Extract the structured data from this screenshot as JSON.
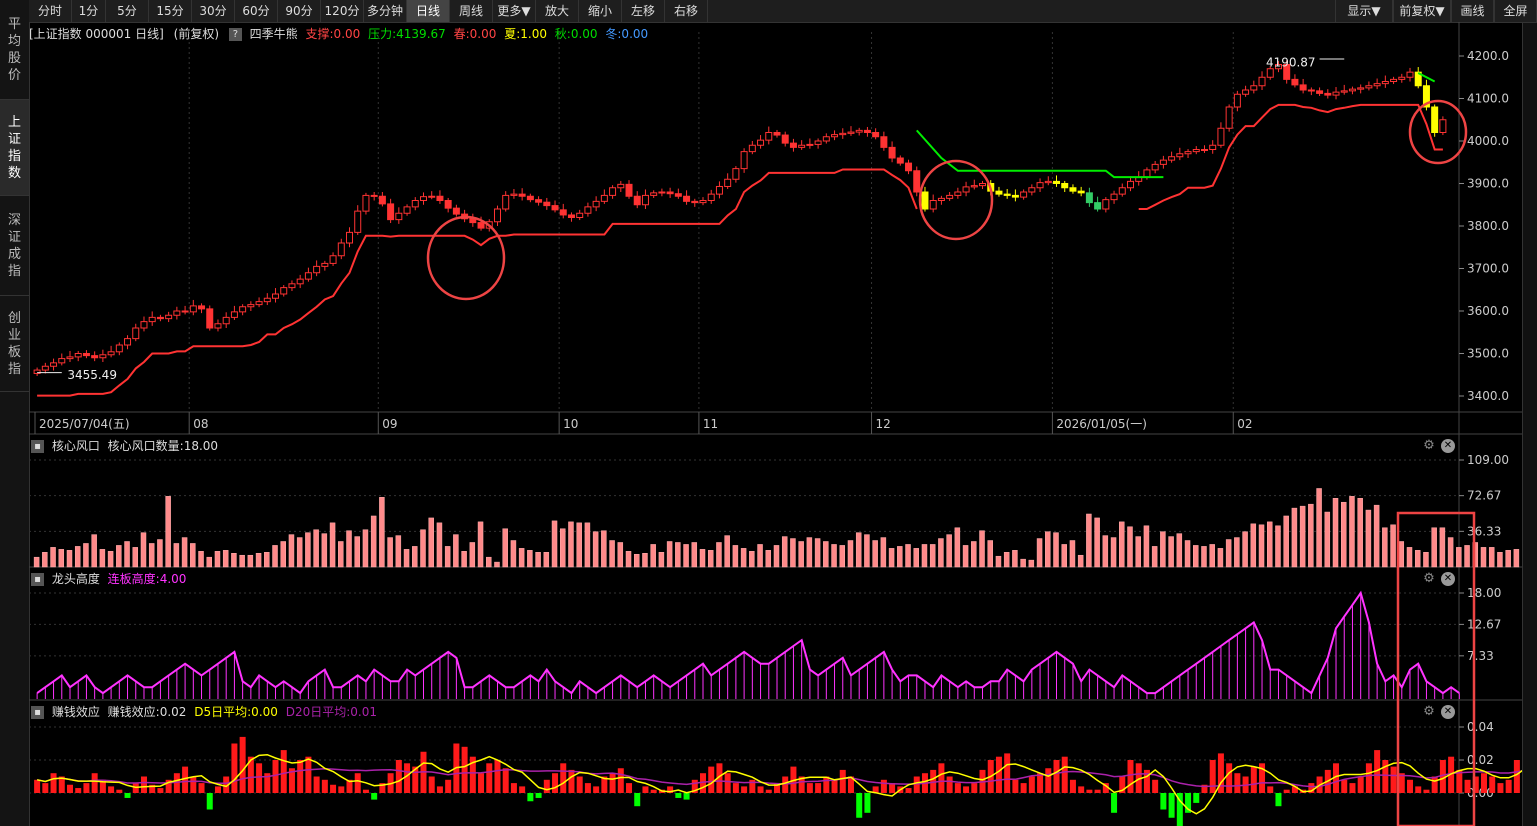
{
  "left_nav": [
    {
      "label": "平均股价"
    },
    {
      "label": "上证指数",
      "active": true
    },
    {
      "label": "深证成指"
    },
    {
      "label": "创业板指"
    }
  ],
  "toolbar": {
    "left": [
      "分时",
      "1分",
      "5分",
      "15分",
      "30分",
      "60分",
      "90分",
      "120分",
      "多分钟",
      "日线",
      "周线",
      "更多▼",
      "放大",
      "缩小",
      "左移",
      "右移"
    ],
    "active": "日线",
    "right": [
      "显示▼",
      "前复权▼",
      "画线",
      "全屏"
    ]
  },
  "info": {
    "security": "[上证指数 000001 日线]",
    "adjust": "(前复权)",
    "indicator": "四季牛熊",
    "support": "支撑:0.00",
    "pressure": "压力:4139.67",
    "spring": "春:0.00",
    "summer": "夏:1.00",
    "autumn": "秋:0.00",
    "winter": "冬:0.00"
  },
  "colors": {
    "up": "#ff3333",
    "down_yellow": "#ffff00",
    "green": "#00ee00",
    "magenta": "#ff33ff",
    "salmon": "#ff8a8a"
  },
  "chart_data": [
    {
      "type": "line",
      "title": "上证指数 000001 日线",
      "ylim": [
        3400,
        4200
      ],
      "y_ticks": [
        "4200.0",
        "4100.0",
        "4000.0",
        "3900.0",
        "3800.0",
        "3700.0",
        "3600.0",
        "3500.0",
        "3400.0"
      ],
      "x_ticks": [
        "2025/07/04(五)",
        "08",
        "09",
        "10",
        "11",
        "12",
        "2026/01/05(一)",
        "02"
      ],
      "annotations": [
        "4190.87",
        "3455.49"
      ],
      "series": [
        {
          "name": "",
          "values": [
            3461,
            3470,
            3478,
            3488,
            3492,
            3500,
            3495,
            3490,
            3497,
            3504,
            3520,
            3535,
            3560,
            3575,
            3585,
            3582,
            3590,
            3600,
            3598,
            3612,
            3605,
            3560,
            3570,
            3585,
            3598,
            3610,
            3615,
            3622,
            3630,
            3640,
            3655,
            3664,
            3675,
            3690,
            3705,
            3712,
            3730,
            3760,
            3785,
            3835,
            3872,
            3870,
            3852,
            3815,
            3830,
            3845,
            3860,
            3869,
            3870,
            3860,
            3842,
            3828,
            3817,
            3808,
            3795,
            3810,
            3840,
            3872,
            3875,
            3870,
            3862,
            3856,
            3848,
            3838,
            3826,
            3820,
            3830,
            3845,
            3858,
            3872,
            3890,
            3898,
            3870,
            3850,
            3872,
            3878,
            3880,
            3876,
            3870,
            3858,
            3855,
            3860,
            3875,
            3893,
            3910,
            3935,
            3975,
            3990,
            4002,
            4020,
            4014,
            3995,
            3985,
            3990,
            3992,
            4000,
            4010,
            4015,
            4018,
            4021,
            4025,
            4020,
            4010,
            3985,
            3960,
            3948,
            3930,
            3880,
            3840,
            3860,
            3865,
            3872,
            3880,
            3892,
            3895,
            3900,
            3882,
            3875,
            3872,
            3868,
            3880,
            3890,
            3902,
            3905,
            3900,
            3890,
            3882,
            3878,
            3855,
            3840,
            3862,
            3875,
            3890,
            3905,
            3915,
            3932,
            3945,
            3955,
            3963,
            3970,
            3975,
            3980,
            3980,
            3990,
            4030,
            4080,
            4110,
            4120,
            4130,
            4150,
            4170,
            4180,
            4145,
            4132,
            4120,
            4118,
            4112,
            4108,
            4115,
            4118,
            4122,
            4125,
            4130,
            4135,
            4140,
            4145,
            4150,
            4162,
            4130,
            4080,
            4020,
            4050
          ]
        }
      ]
    },
    {
      "type": "bar",
      "title": "核心风口",
      "label": "核心风口数量:18.00",
      "ylim": [
        0,
        109
      ],
      "y_ticks": [
        "109.00",
        "72.67",
        "36.33"
      ],
      "series": [
        {
          "name": "核心风口数量",
          "values": [
            10,
            15,
            20,
            18,
            17,
            21,
            24,
            33,
            18,
            16,
            22,
            26,
            20,
            35,
            24,
            28,
            72,
            24,
            30,
            24,
            16,
            10,
            16,
            17,
            14,
            12,
            12,
            14,
            15,
            22,
            26,
            33,
            30,
            35,
            38,
            34,
            45,
            26,
            37,
            31,
            38,
            52,
            71,
            30,
            32,
            18,
            21,
            38,
            50,
            45,
            21,
            33,
            16,
            25,
            46,
            10,
            5,
            39,
            27,
            19,
            17,
            15,
            15,
            47,
            39,
            46,
            45,
            45,
            36,
            37,
            27,
            25,
            16,
            13,
            14,
            23,
            15,
            26,
            25,
            23,
            25,
            18,
            17,
            25,
            32,
            22,
            19,
            16,
            23,
            17,
            22,
            31,
            29,
            26,
            30,
            29,
            26,
            23,
            22,
            27,
            35,
            33,
            27,
            30,
            19,
            21,
            23,
            19,
            23,
            23,
            29,
            33,
            40,
            22,
            26,
            37,
            27,
            11,
            15,
            17,
            8,
            7,
            29,
            36,
            35,
            23,
            27,
            12,
            54,
            50,
            32,
            30,
            46,
            41,
            31,
            42,
            21,
            36,
            31,
            34,
            27,
            22,
            21,
            23,
            19,
            28,
            30,
            36,
            44,
            43,
            46,
            42,
            52,
            60,
            62,
            64,
            80,
            56,
            70,
            66,
            72,
            70,
            58,
            63,
            40,
            43,
            26,
            20,
            17,
            15,
            40,
            40,
            30,
            20,
            22,
            25,
            20,
            20,
            15,
            17,
            18
          ]
        }
      ]
    },
    {
      "type": "line",
      "title": "龙头高度",
      "label": "连板高度:4.00",
      "ylim": [
        0,
        18
      ],
      "y_ticks": [
        "18.00",
        "12.67",
        "7.33"
      ],
      "series": [
        {
          "name": "连板高度",
          "values": [
            1,
            2,
            3,
            4,
            2,
            3,
            4,
            2,
            1,
            2,
            3,
            4,
            3,
            2,
            2,
            3,
            4,
            5,
            6,
            5,
            4,
            5,
            6,
            7,
            8,
            3,
            2,
            4,
            3,
            2,
            3,
            2,
            1,
            3,
            4,
            5,
            2,
            2,
            3,
            4,
            3,
            5,
            4,
            3,
            3,
            5,
            4,
            5,
            6,
            7,
            8,
            7,
            2,
            2,
            3,
            4,
            3,
            2,
            2,
            3,
            4,
            3,
            5,
            3,
            2,
            1,
            3,
            2,
            1,
            2,
            3,
            4,
            3,
            2,
            3,
            4,
            3,
            2,
            3,
            4,
            5,
            6,
            4,
            5,
            6,
            7,
            8,
            7,
            6,
            6,
            7,
            8,
            9,
            10,
            5,
            4,
            5,
            6,
            7,
            4,
            5,
            6,
            7,
            8,
            5,
            3,
            4,
            4,
            3,
            2,
            4,
            3,
            2,
            3,
            2,
            2,
            3,
            3,
            5,
            4,
            3,
            5,
            6,
            7,
            8,
            7,
            6,
            3,
            5,
            4,
            3,
            2,
            4,
            3,
            2,
            1,
            1,
            2,
            3,
            4,
            5,
            6,
            7,
            8,
            9,
            10,
            11,
            12,
            13,
            10,
            5,
            5,
            4,
            3,
            2,
            1,
            4,
            7,
            12,
            14,
            16,
            18,
            13,
            6,
            3,
            4,
            2,
            5,
            6,
            3,
            2,
            1,
            2,
            1
          ]
        }
      ]
    },
    {
      "type": "bar",
      "title": "赚钱效应",
      "label": "赚钱效应:0.02",
      "ma5_label": "D5日平均:0.00",
      "ma20_label": "D20日平均:0.01",
      "ylim": [
        -0.02,
        0.04
      ],
      "y_ticks": [
        "0.04",
        "0.02",
        "0.00"
      ],
      "series": [
        {
          "name": "赚钱效应",
          "values": [
            0.008,
            0.006,
            0.012,
            0.01,
            0.005,
            0.003,
            0.006,
            0.012,
            0.008,
            0.004,
            0.002,
            -0.003,
            0.006,
            0.01,
            0.005,
            0.003,
            0.008,
            0.012,
            0.016,
            0.01,
            0.006,
            -0.01,
            0.004,
            0.01,
            0.03,
            0.034,
            0.022,
            0.018,
            0.012,
            0.02,
            0.026,
            0.015,
            0.02,
            0.022,
            0.01,
            0.008,
            0.005,
            0.004,
            0.008,
            0.012,
            0.002,
            -0.004,
            0.006,
            0.012,
            0.02,
            0.018,
            0.016,
            0.025,
            0.01,
            0.004,
            0.008,
            0.03,
            0.028,
            0.022,
            0.012,
            0.018,
            0.02,
            0.015,
            0.006,
            0.004,
            -0.005,
            -0.003,
            0.008,
            0.012,
            0.018,
            0.014,
            0.01,
            0.006,
            0.004,
            0.01,
            0.012,
            0.015,
            0.006,
            -0.008,
            0.004,
            0.002,
            0.002,
            0.004,
            -0.003,
            -0.004,
            0.008,
            0.012,
            0.016,
            0.018,
            0.012,
            0.006,
            0.004,
            0.008,
            0.004,
            0.002,
            0.006,
            0.01,
            0.016,
            0.01,
            0.006,
            0.006,
            0.01,
            0.008,
            0.014,
            0.01,
            -0.015,
            -0.012,
            0.004,
            0.008,
            0.006,
            0.004,
            0.003,
            0.01,
            0.012,
            0.014,
            0.018,
            0.01,
            0.006,
            0.004,
            0.006,
            0.014,
            0.02,
            0.022,
            0.024,
            0.008,
            0.006,
            0.01,
            0.012,
            0.015,
            0.02,
            0.022,
            0.008,
            0.004,
            0.002,
            0.002,
            0.006,
            -0.012,
            0.01,
            0.02,
            0.018,
            0.014,
            0.008,
            -0.01,
            -0.015,
            -0.02,
            -0.012,
            -0.006,
            0.005,
            0.02,
            0.024,
            0.018,
            0.012,
            0.01,
            0.016,
            0.018,
            0.004,
            -0.008,
            0.002,
            0.004,
            0.002,
            0.006,
            0.01,
            0.014,
            0.018,
            0.008,
            0.006,
            0.01,
            0.018,
            0.026,
            0.02,
            0.016,
            0.012,
            0.008,
            0.004,
            0.002,
            0.01,
            0.02,
            0.022,
            0.014,
            0.008,
            0.01,
            0.012,
            0.01,
            0.006,
            0.008,
            0.02,
            0.03,
            0.022,
            0.014,
            -0.015,
            -0.012,
            0.008,
            -0.006,
            -0.004,
            0.02
          ]
        }
      ]
    }
  ]
}
